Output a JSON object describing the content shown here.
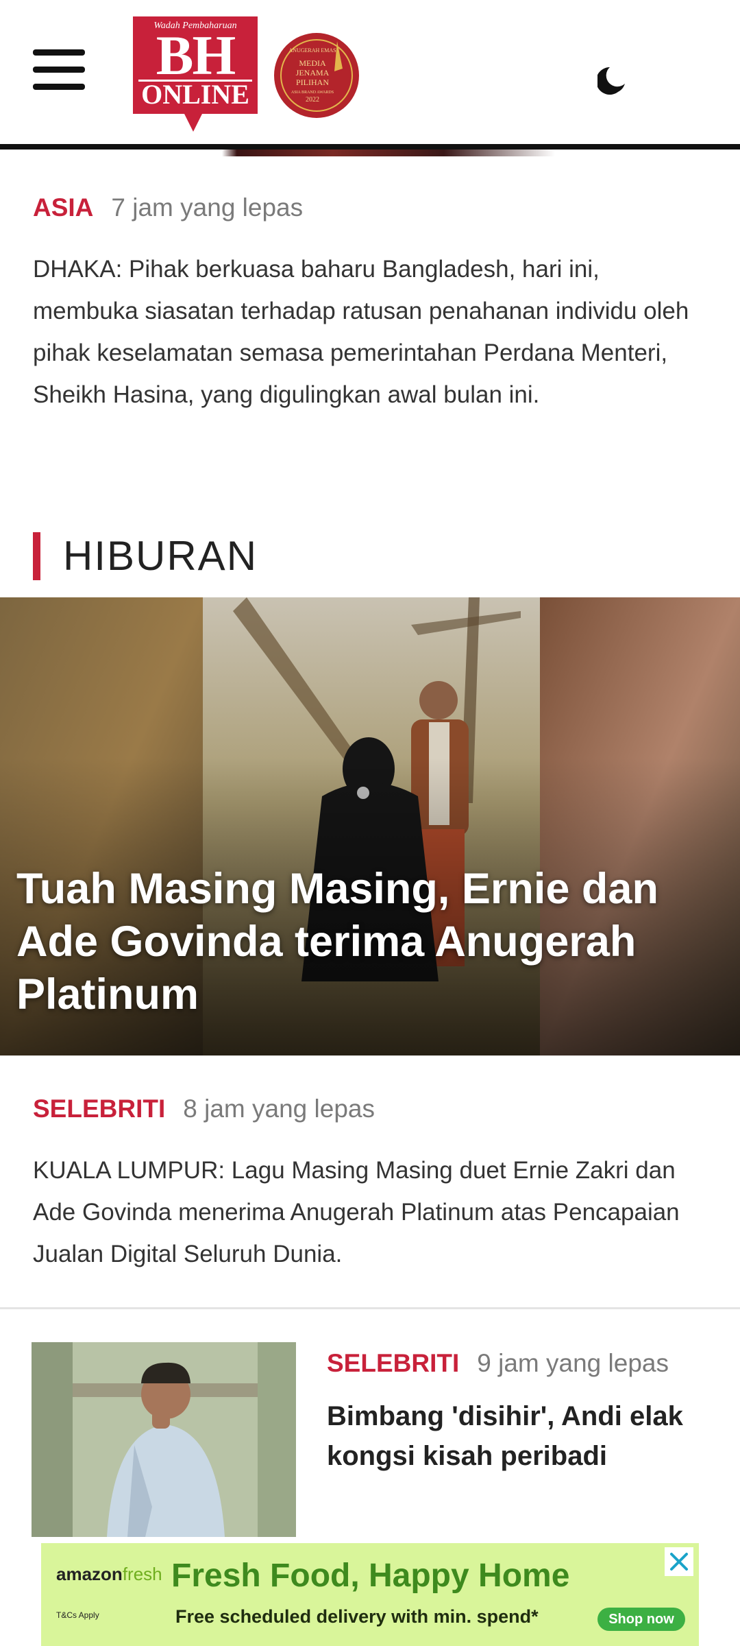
{
  "header": {
    "menu_icon": "hamburger-menu-icon",
    "logo": {
      "tagline": "Wadah Pembaharuan",
      "main": "BH",
      "sub": "ONLINE"
    },
    "award_badge": {
      "line1": "ANUGERAH EMAS",
      "line2": "MEDIA",
      "line3": "JENAMA",
      "line4": "PILIHAN",
      "line5": "ASIA BRAND AWARDS",
      "year": "2022"
    },
    "theme_icon": "moon-icon"
  },
  "article_top": {
    "category": "ASIA",
    "time": "7 jam yang lepas",
    "excerpt": "DHAKA: Pihak berkuasa baharu Bangladesh, hari ini, membuka siasatan terhadap ratusan penahanan individu oleh pihak keselamatan semasa pemerintahan Perdana Menteri, Sheikh Hasina, yang digulingkan awal bulan ini."
  },
  "section": {
    "title": "HIBURAN"
  },
  "hero": {
    "title": "Tuah Masing Masing, Ernie dan Ade Govinda terima Anugerah Platinum",
    "category": "SELEBRITI",
    "time": "8 jam yang lepas",
    "excerpt": "KUALA LUMPUR: Lagu Masing Masing duet Ernie Zakri dan Ade Govinda menerima Anugerah Platinum atas Pencapaian Jualan Digital Seluruh Dunia."
  },
  "list_item": {
    "category": "SELEBRITI",
    "time": "9 jam yang lepas",
    "title": "Bimbang 'disihir', Andi elak kongsi kisah peribadi"
  },
  "ad": {
    "brand_a": "amazon",
    "brand_b": "fresh",
    "fine_print": "T&Cs Apply",
    "headline": "Fresh Food, Happy Home",
    "sub": "Free scheduled delivery with min. spend*",
    "button": "Shop now",
    "close_icon": "close-icon"
  },
  "colors": {
    "accent": "#c8213a",
    "muted": "#7a7a7a",
    "ad_bg": "#d9f59a"
  }
}
